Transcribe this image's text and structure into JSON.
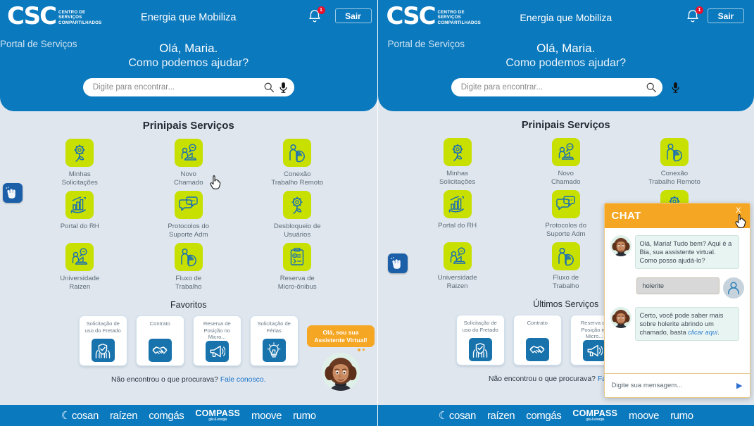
{
  "header": {
    "logo_main": "CSC",
    "logo_sub_lines": [
      "CENTRO DE",
      "SERVIÇOS",
      "COMPARTILHADOS"
    ],
    "slogan": "Energia que Mobiliza",
    "portal_label": "Portal de Serviços",
    "notification_count": "1",
    "logout_label": "Sair",
    "greeting_line1": "Olá, Maria.",
    "greeting_line2": "Como podemos ajudar?",
    "search_placeholder": "Digite para encontrar...",
    "search_value": "",
    "icons": {
      "bell": "bell-icon",
      "search": "search-icon",
      "mic": "microphone-icon"
    },
    "colors": {
      "brand_blue": "#0b79bd",
      "badge_red": "#e8112d"
    }
  },
  "main": {
    "services_title": "Prinipais Serviços",
    "services": [
      {
        "label": "Minhas\nSolicitações",
        "icon": "flower-gear-icon"
      },
      {
        "label": "Novo\nChamado",
        "icon": "person-laptop-chat-icon"
      },
      {
        "label": "Conexão\nTrabalho Remoto",
        "icon": "person-piechart-icon"
      },
      {
        "label": "Portal do RH",
        "icon": "hand-barchart-icon"
      },
      {
        "label": "Protocolos do\nSuporte  Adm",
        "icon": "chat-bubbles-icon"
      },
      {
        "label": "Desbloqueio de\nUsuários",
        "icon": "flower-gear-icon"
      },
      {
        "label": "Universidade\nRaizen",
        "icon": "person-laptop-chat-icon"
      },
      {
        "label": "Fluxo de\nTrabalho",
        "icon": "person-piechart-icon"
      },
      {
        "label": "Reserva de\nMicro-ônibus",
        "icon": "clipboard-gear-icon"
      }
    ],
    "favorites_title_left": "Favoritos",
    "favorites_title_right": "Últimos Serviços",
    "favorites": [
      {
        "label": "Solicitação de\nuso do Fretado",
        "icon": "hands-shield-check-icon"
      },
      {
        "label": "Contrato",
        "icon": "handshake-icon"
      },
      {
        "label": "Reserva de\nPosição no\nMicro...",
        "icon": "megaphone-icon"
      },
      {
        "label": "Solicitação de\nFérias",
        "icon": "lightbulb-icon"
      }
    ],
    "not_found_text": "Não encontrou o que procurava?",
    "not_found_link": "Fale conosco.",
    "accessibility_icon": "vlibras-hands-icon",
    "colors": {
      "tile_green": "#c7e000",
      "fav_icon_blue": "#1873ad",
      "page_bg": "#dfe6ee"
    }
  },
  "assistant": {
    "bubble_line1": "Olá, sou sua",
    "bubble_line2": "Assistente Virtual!",
    "avatar_name": "assistant-avatar"
  },
  "chat": {
    "title": "CHAT",
    "close_label": "X",
    "messages": [
      {
        "from": "bot",
        "text": "Olá, Maria! Tudo bem? Aqui é a Bia, sua assistente virtual. Como posso ajudá-lo?"
      },
      {
        "from": "user",
        "text": "holerite"
      },
      {
        "from": "bot",
        "text": "Certo, você pode saber mais sobre holerite abrindo um chamado, basta ",
        "link": "clicar aqui",
        "tail": "."
      }
    ],
    "input_placeholder": "Digite sua mensagem...",
    "send_icon": "send-arrow-icon",
    "colors": {
      "header_orange": "#f5a623",
      "bot_bubble": "#e8f4f2",
      "user_bubble": "#d8d8d8"
    }
  },
  "footer": {
    "brands": [
      "cosan",
      "raízen",
      "comgás",
      "COMPASS",
      "moove",
      "rumo"
    ],
    "compass_tagline": "gás & energia"
  }
}
